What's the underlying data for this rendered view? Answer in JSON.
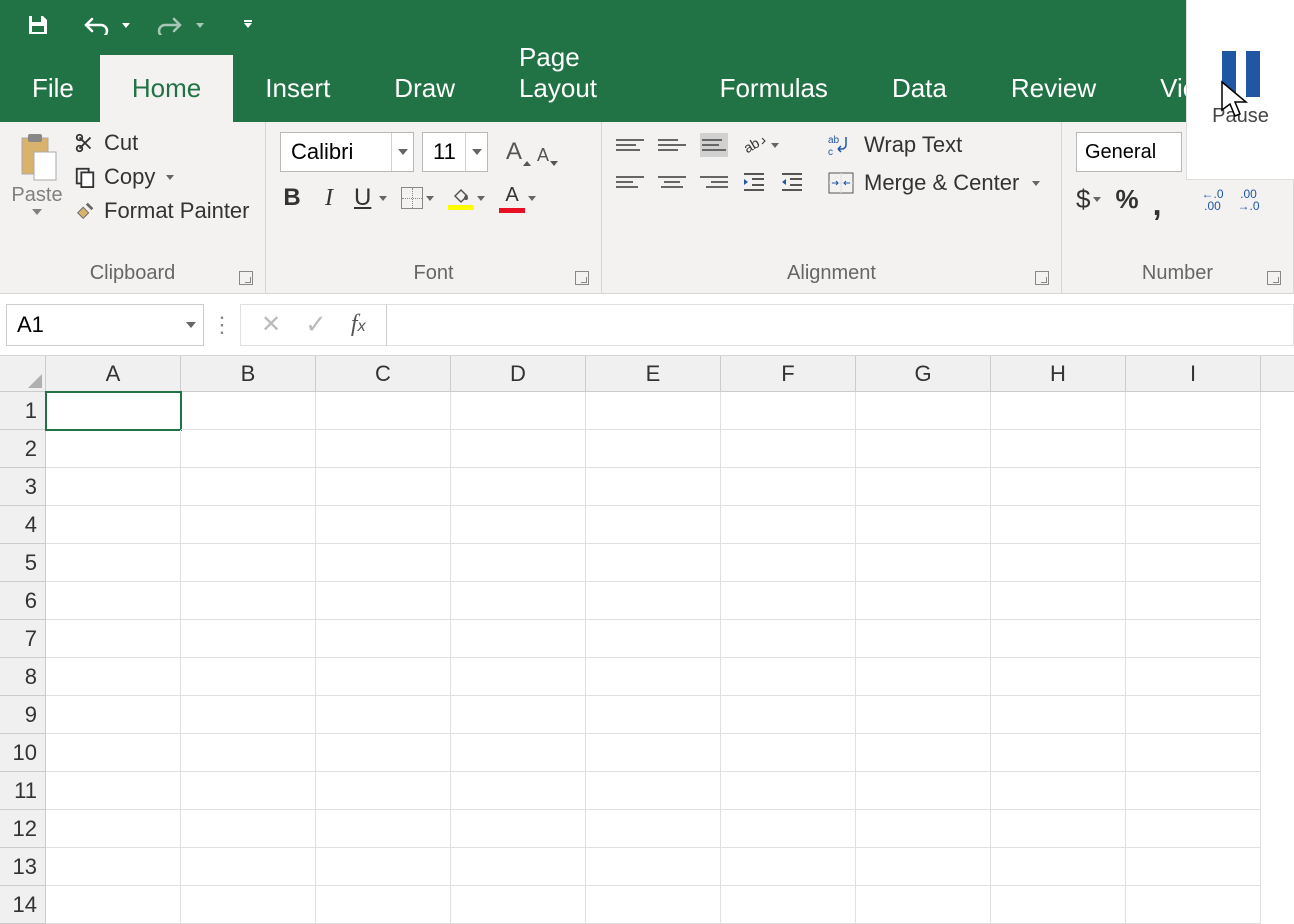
{
  "quickAccess": {
    "save": "save",
    "undo": "undo",
    "redo": "redo"
  },
  "tabs": {
    "file": "File",
    "home": "Home",
    "insert": "Insert",
    "draw": "Draw",
    "pageLayout": "Page Layout",
    "formulas": "Formulas",
    "data": "Data",
    "review": "Review",
    "view": "View",
    "active": "home"
  },
  "ribbon": {
    "clipboard": {
      "label": "Clipboard",
      "paste": "Paste",
      "cut": "Cut",
      "copy": "Copy",
      "formatPainter": "Format Painter"
    },
    "font": {
      "label": "Font",
      "name": "Calibri",
      "size": "11"
    },
    "alignment": {
      "label": "Alignment",
      "wrapText": "Wrap Text",
      "mergeCenter": "Merge & Center"
    },
    "number": {
      "label": "Number",
      "format": "General"
    }
  },
  "namebox": "A1",
  "formula": "",
  "columns": [
    "A",
    "B",
    "C",
    "D",
    "E",
    "F",
    "G",
    "H",
    "I"
  ],
  "rows": [
    "1",
    "2",
    "3",
    "4",
    "5",
    "6",
    "7",
    "8",
    "9",
    "10",
    "11",
    "12",
    "13",
    "14"
  ],
  "selected": {
    "row": 0,
    "col": 0
  },
  "pause": {
    "label": "Pause"
  }
}
